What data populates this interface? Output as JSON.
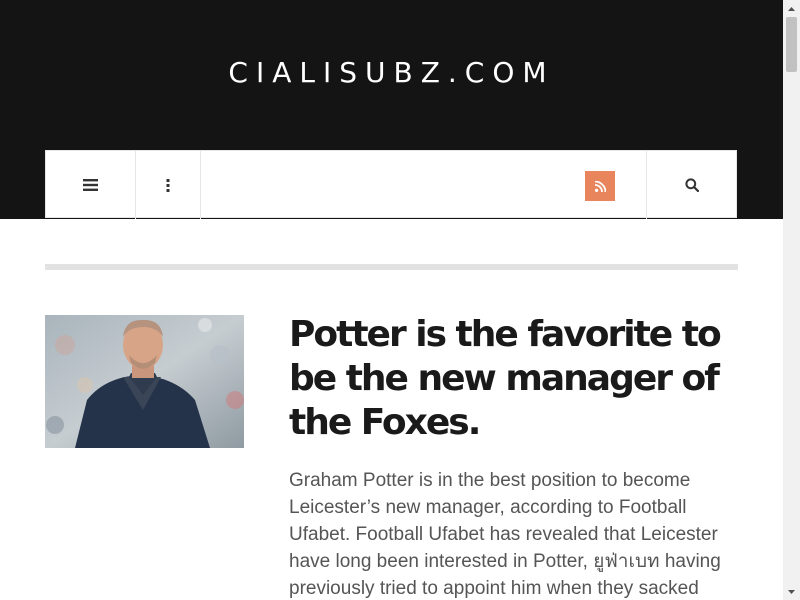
{
  "site": {
    "title": "CIALISUBZ.COM"
  },
  "nav": {
    "menu_icon": "hamburger-menu-icon",
    "more_icon": "vertical-dots-icon",
    "rss_icon": "rss-feed-icon",
    "search_icon": "search-icon",
    "rss_color": "#e8855d"
  },
  "post": {
    "title": "Potter is the favorite to be the new manager of the Foxes.",
    "excerpt": "Graham Potter is in the best position to become Leicester’s new manager, according to Football Ufabet. Football Ufabet has revealed that Leicester have long been interested in Potter, ยูฟ่าเบท having previously tried to appoint him when they sacked"
  },
  "colors": {
    "header_bg": "#141414",
    "title_text": "#1a1a1a",
    "body_text": "#555555"
  }
}
